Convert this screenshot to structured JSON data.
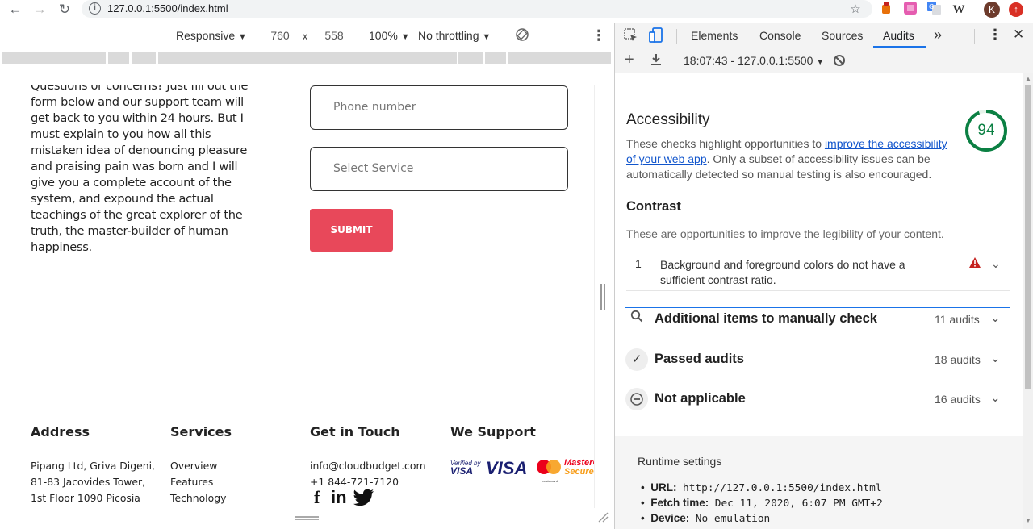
{
  "browser": {
    "url": "127.0.0.1:5500/index.html",
    "profile_initial": "K"
  },
  "device_toolbar": {
    "device": "Responsive",
    "width": "760",
    "times": "x",
    "height": "558",
    "zoom": "100%",
    "throttling": "No throttling"
  },
  "page": {
    "paragraph": "Questions or concerns? Just fill out the form below and our support team will get back to you within 24 hours. But I must explain to you how all this mistaken idea of denouncing pleasure and praising pain was born and I will give you a complete account of the system, and expound the actual teachings of the great explorer of the truth, the master-builder of human happiness.",
    "phone_placeholder": "Phone number",
    "service_placeholder": "Select Service",
    "submit_label": "SUBMIT",
    "footer": {
      "address_title": "Address",
      "address_lines": [
        "Pipang Ltd, Griva Digeni,",
        "81-83 Jacovides Tower,",
        "1st Floor 1090 Picosia"
      ],
      "services_title": "Services",
      "services_lines": [
        "Overview",
        "Features",
        "Technology"
      ],
      "contact_title": "Get in Touch",
      "contact_lines": [
        "info@cloudbudget.com",
        "+1 844-721-7120"
      ],
      "support_title": "We Support",
      "payment": {
        "verified_top": "Verified by",
        "verified_bottom": "VISA",
        "visa": "VISA",
        "master_top": "MasterC",
        "master_bottom": "SecureC",
        "master_small": "mastercard"
      }
    }
  },
  "devtools": {
    "tabs": [
      "Elements",
      "Console",
      "Sources",
      "Audits"
    ],
    "active_tab": "Audits",
    "more": "»",
    "report_selector": "18:07:43 - 127.0.0.1:5500",
    "category_title": "Accessibility",
    "score": "94",
    "score_color": "#0b8043",
    "description_prefix": "These checks highlight opportunities to ",
    "description_link": "improve the accessibility of your web app",
    "description_suffix": ". Only a subset of accessibility issues can be automatically detected so manual testing is also encouraged.",
    "contrast_title": "Contrast",
    "contrast_desc": "These are opportunities to improve the legibility of your content.",
    "contrast_item_number": "1",
    "contrast_item_text": "Background and foreground colors do not have a sufficient contrast ratio.",
    "groups": [
      {
        "title": "Additional items to manually check",
        "count": "11 audits",
        "icon": "search-icon"
      },
      {
        "title": "Passed audits",
        "count": "18 audits",
        "icon": "check-icon"
      },
      {
        "title": "Not applicable",
        "count": "16 audits",
        "icon": "minus-icon"
      }
    ],
    "runtime": {
      "title": "Runtime settings",
      "url_label": "URL:",
      "url_value": "http://127.0.0.1:5500/index.html",
      "fetch_label": "Fetch time:",
      "fetch_value": "Dec 11, 2020, 6:07 PM GMT+2",
      "device_label": "Device:",
      "device_value": "No emulation"
    }
  }
}
